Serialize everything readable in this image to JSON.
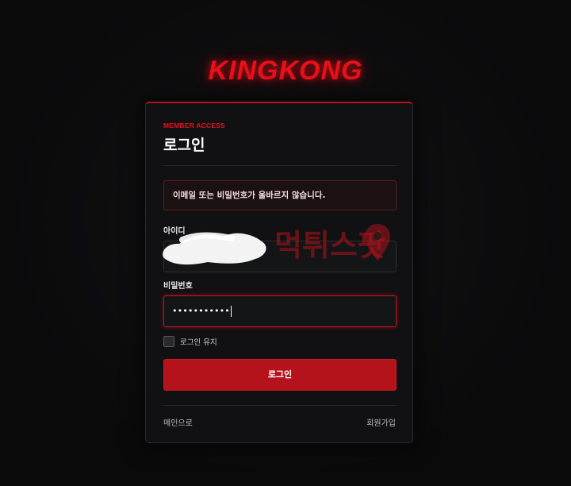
{
  "brand": {
    "logo_text": "KINGKONG",
    "accent_color": "#e8101a"
  },
  "login": {
    "eyebrow": "MEMBER ACCESS",
    "title": "로그인",
    "error_message": "이메일 또는 비밀번호가 올바르지 않습니다.",
    "id_label": "아이디",
    "id_value": "",
    "password_label": "비밀번호",
    "password_value": "•••••••••••",
    "remember_label": "로그인 유지",
    "remember_checked": false,
    "submit_label": "로그인"
  },
  "footer": {
    "home_link": "메인으로",
    "signup_link": "회원가입"
  },
  "watermark": {
    "text": "먹튀스팟"
  }
}
